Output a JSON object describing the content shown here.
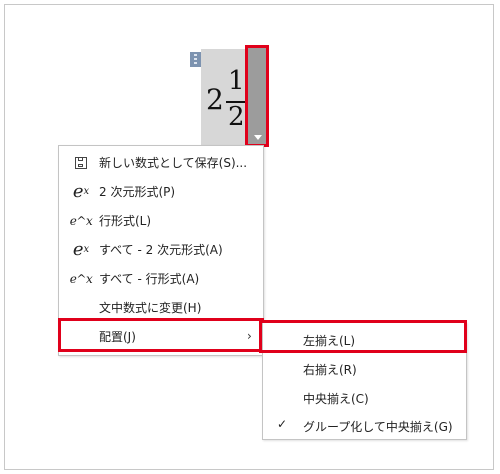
{
  "equation": {
    "integer": "2",
    "numerator": "1",
    "denominator": "2",
    "cursor_mark": "¦"
  },
  "context_menu": {
    "items": [
      {
        "icon": "save-icon",
        "label": "新しい数式として保存(S)..."
      },
      {
        "icon": "professional-format-icon",
        "icon_text": "e",
        "icon_sup": "x",
        "label": "2 次元形式(P)"
      },
      {
        "icon": "linear-format-icon",
        "icon_text": "e^x",
        "label": "行形式(L)"
      },
      {
        "icon": "professional-format-all-icon",
        "icon_text": "e",
        "icon_sup": "x",
        "label": "すべて - 2 次元形式(A)"
      },
      {
        "icon": "linear-format-all-icon",
        "icon_text": "e^x",
        "label": "すべて - 行形式(A)"
      },
      {
        "label": "文中数式に変更(H)"
      },
      {
        "label": "配置(J)",
        "submenu_arrow": "›"
      }
    ]
  },
  "justification_submenu": {
    "items": [
      {
        "label": "左揃え(L)"
      },
      {
        "label": "右揃え(R)"
      },
      {
        "label": "中央揃え(C)"
      },
      {
        "label": "グループ化して中央揃え(G)",
        "checked": true,
        "check_mark": "✓"
      }
    ]
  },
  "colors": {
    "highlight": "#e0001b",
    "equation_background": "#d7d7d7",
    "equation_tab": "#9c9c9c"
  }
}
